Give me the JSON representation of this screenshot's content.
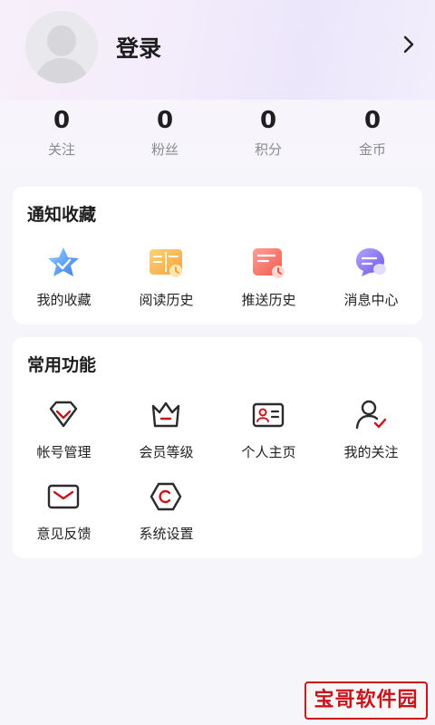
{
  "profile": {
    "login_label": "登录"
  },
  "stats": [
    {
      "value": "0",
      "label": "关注"
    },
    {
      "value": "0",
      "label": "粉丝"
    },
    {
      "value": "0",
      "label": "积分"
    },
    {
      "value": "0",
      "label": "金币"
    }
  ],
  "notify_section": {
    "title": "通知收藏",
    "items": [
      {
        "label": "我的收藏",
        "icon": "star-favorites-icon"
      },
      {
        "label": "阅读历史",
        "icon": "book-history-icon"
      },
      {
        "label": "推送历史",
        "icon": "push-history-icon"
      },
      {
        "label": "消息中心",
        "icon": "message-center-icon"
      }
    ]
  },
  "common_section": {
    "title": "常用功能",
    "items": [
      {
        "label": "帐号管理",
        "icon": "account-manage-icon"
      },
      {
        "label": "会员等级",
        "icon": "crown-icon"
      },
      {
        "label": "个人主页",
        "icon": "id-card-icon"
      },
      {
        "label": "我的关注",
        "icon": "user-follow-icon"
      },
      {
        "label": "意见反馈",
        "icon": "mail-feedback-icon"
      },
      {
        "label": "系统设置",
        "icon": "settings-hex-icon"
      }
    ]
  },
  "watermark": {
    "text": "宝哥软件园"
  },
  "colors": {
    "accent_red": "#c9141c",
    "icon_dark": "#2b2b2e"
  }
}
